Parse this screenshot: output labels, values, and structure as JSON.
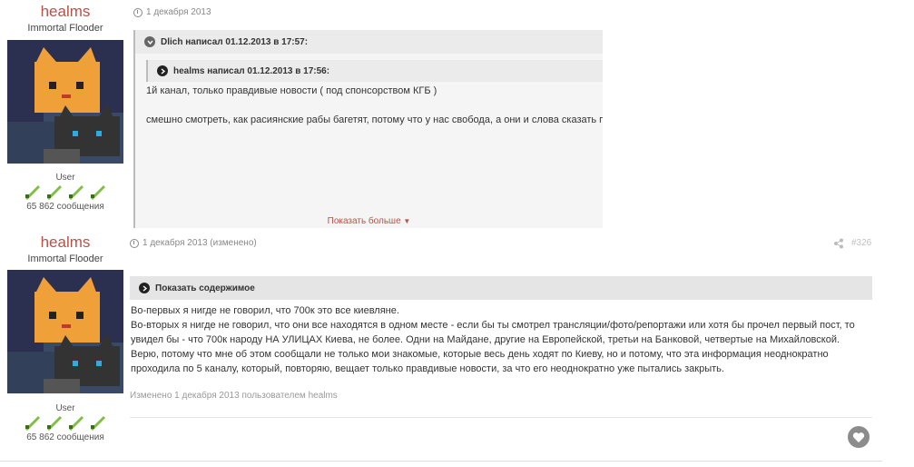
{
  "posts": [
    {
      "author": {
        "name": "healms",
        "title": "Immortal Flooder",
        "role": "User",
        "count": "65 862 сообщения"
      },
      "date": "1 декабря 2013",
      "quote": {
        "outer_header": "Dlich написал 01.12.2013 в 17:57:",
        "inner_header": "healms написал 01.12.2013 в 17:56:",
        "line1": "1й канал, только правдивые новости ( под спонсорством КГБ )",
        "line2": "смешно смотреть, как расиянские рабы багетят, потому что у нас свобода, а они и слова сказать про",
        "show_more": "Показать больше"
      }
    },
    {
      "author": {
        "name": "healms",
        "title": "Immortal Flooder",
        "role": "User",
        "count": "65 862 сообщения"
      },
      "date": "1 декабря 2013 (изменено)",
      "post_number": "#326",
      "spoiler_label": "Показать содержимое",
      "paragraphs": [
        "Во-первых я нигде не говорил, что 700к это все киевляне.",
        "Во-вторых я нигде не говорил, что они все находятся в одном месте - если бы ты смотрел трансляции/фото/репортажи или хотя бы прочел первый пост, то увидел бы - что 700к народу НА УЛИЦАХ Киева, не более. Одни на Майдане, другие на Европейской, третьи на Банковой, четвертые на Михайловской.",
        "Верю, потому что мне об этом сообщали не только мои знакомые, которые весь день ходят по Киеву, но и потому, что эта информация неоднократно проходила по 5 каналу, который, повторяю, вещает только правдивые новости, за что его неоднократно уже пытались закрыть."
      ],
      "edited_note": "Изменено 1 декабря 2013 пользователем healms"
    }
  ],
  "icons": {
    "clock": "clock-icon",
    "share": "share-icon",
    "like": "heart-icon",
    "badge": "sword-badge-icon",
    "chevron": "chevron-right-icon"
  },
  "colors": {
    "username": "#b5524b",
    "online": "#3aa35c"
  }
}
